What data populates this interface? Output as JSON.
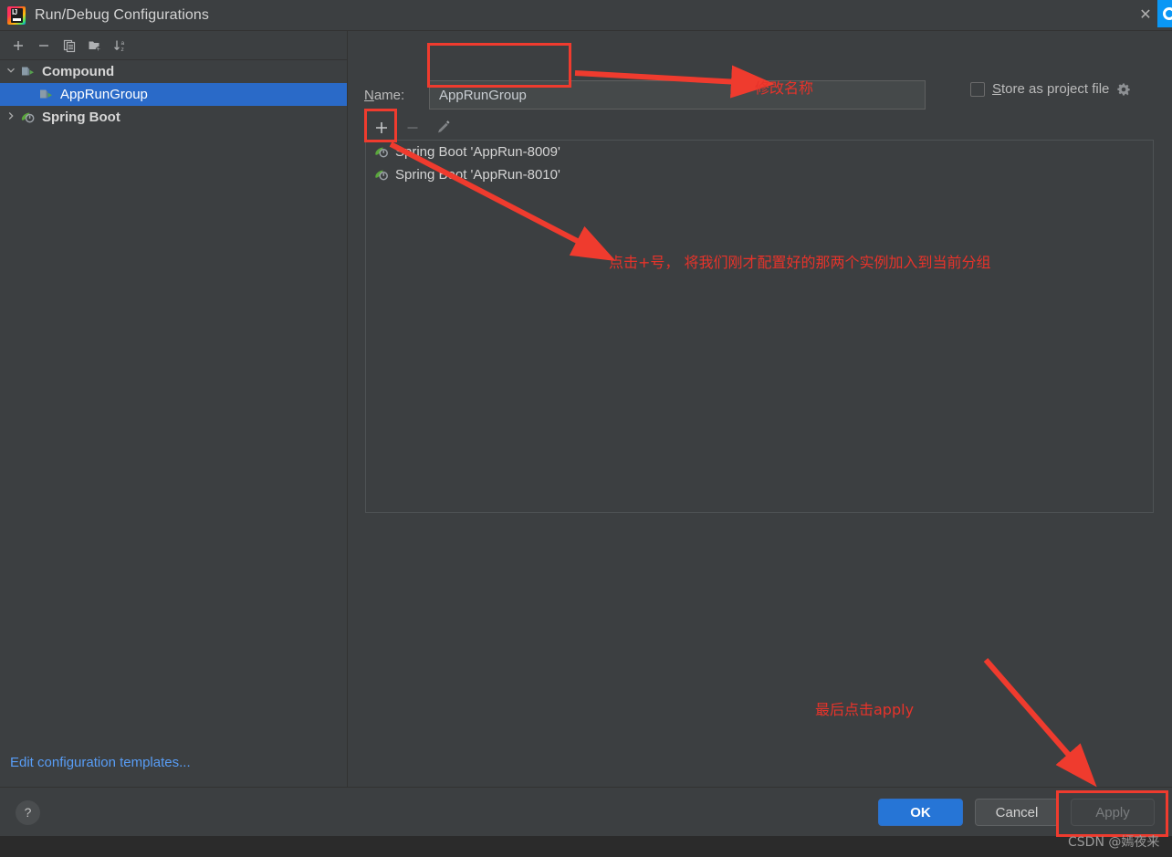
{
  "window": {
    "title": "Run/Debug Configurations",
    "app_icon": "intellij-idea-icon",
    "close_icon": "close-icon",
    "ij_letters": "IJ"
  },
  "sidebar": {
    "toolbar": [
      {
        "name": "add-configuration-button",
        "icon": "plus-icon",
        "label": "+"
      },
      {
        "name": "remove-configuration-button",
        "icon": "minus-icon",
        "label": "−"
      },
      {
        "name": "copy-configuration-button",
        "icon": "copy-icon",
        "label": "Copy"
      },
      {
        "name": "move-into-folder-button",
        "icon": "new-folder-icon",
        "label": "Folder"
      },
      {
        "name": "sort-configurations-button",
        "icon": "sort-az-icon",
        "label": "Sort"
      }
    ],
    "tree": [
      {
        "label": "Compound",
        "twisty": "chevron-down-icon",
        "icon": "compound-folder-icon",
        "depth": 0,
        "selected": false,
        "bold": true
      },
      {
        "label": "AppRunGroup",
        "twisty": "",
        "icon": "compound-folder-icon",
        "depth": 1,
        "selected": true,
        "bold": false
      },
      {
        "label": "Spring Boot",
        "twisty": "chevron-right-icon",
        "icon": "spring-boot-icon",
        "depth": 0,
        "selected": false,
        "bold": true
      }
    ],
    "edit_templates_link": "Edit configuration templates..."
  },
  "main": {
    "name_label_prefix": "N",
    "name_label_rest": "ame:",
    "name_value": "AppRunGroup",
    "name_placeholder": "",
    "store_as_project_file": {
      "label_prefix": "S",
      "label_rest": "tore as project file",
      "checked": false,
      "gear_icon": "gear-dropdown-icon"
    },
    "list_toolbar": [
      {
        "name": "add-item-button",
        "icon": "plus-icon",
        "enabled": true
      },
      {
        "name": "remove-item-button",
        "icon": "minus-icon",
        "enabled": false
      },
      {
        "name": "edit-item-button",
        "icon": "pencil-icon",
        "enabled": false
      }
    ],
    "list_items": [
      {
        "label": "Spring Boot 'AppRun-8009'",
        "icon": "spring-boot-icon"
      },
      {
        "label": "Spring Boot 'AppRun-8010'",
        "icon": "spring-boot-icon"
      }
    ]
  },
  "footer": {
    "help_label": "?",
    "ok_label": "OK",
    "cancel_label": "Cancel",
    "apply_label": "Apply"
  },
  "annotations": {
    "rename_note": "修改名称",
    "plus_note": "点击+号， 将我们刚才配置好的那两个实例加入到当前分组",
    "apply_note": "最后点击apply",
    "watermark": "CSDN @嫣夜来"
  },
  "colors": {
    "background": "#3c3f41",
    "selection_blue": "#2a6ac8",
    "accent_link": "#589df6",
    "annotation_red": "#e8332a",
    "ok_button": "#2675d6",
    "spring_green": "#4a9c2e"
  }
}
